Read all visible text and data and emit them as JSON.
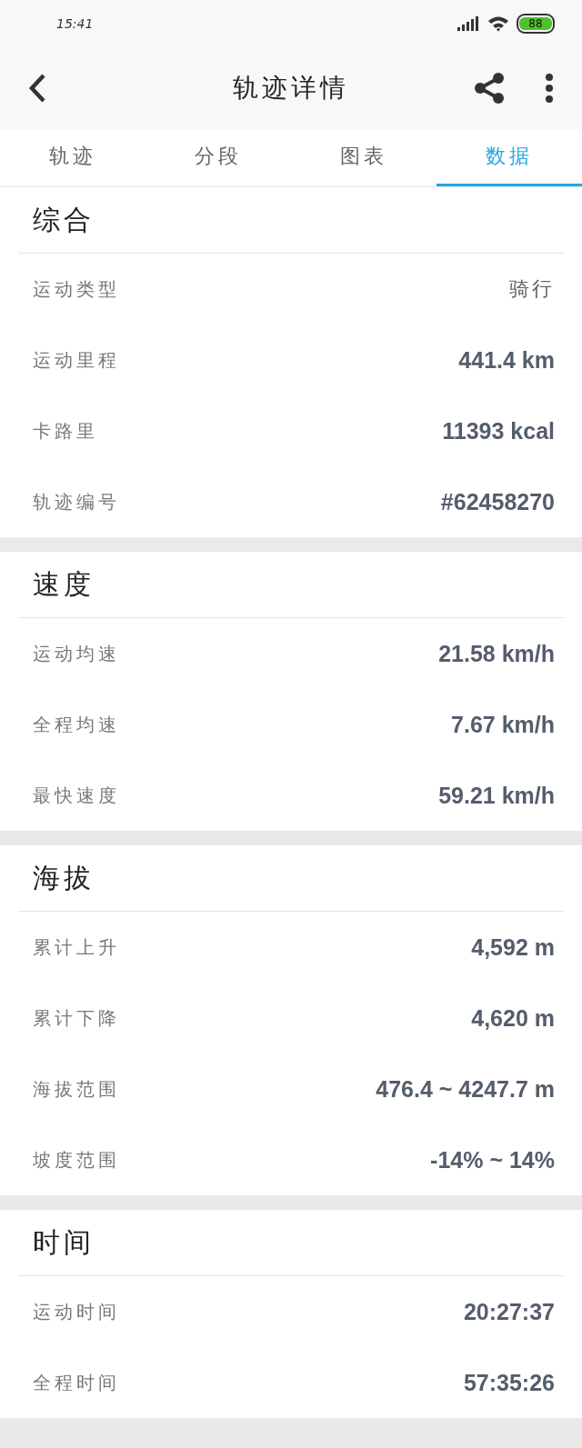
{
  "status_bar": {
    "time": "15:41",
    "battery": "88"
  },
  "toolbar": {
    "title": "轨迹详情"
  },
  "tabs": [
    {
      "label": "轨迹",
      "selected": false
    },
    {
      "label": "分段",
      "selected": false
    },
    {
      "label": "图表",
      "selected": false
    },
    {
      "label": "数据",
      "selected": true
    }
  ],
  "sections": [
    {
      "title": "综合",
      "rows": [
        {
          "label": "运动类型",
          "value": "骑行",
          "kind": "text"
        },
        {
          "label": "运动里程",
          "value": "441.4 km",
          "kind": "number"
        },
        {
          "label": "卡路里",
          "value": "11393 kcal",
          "kind": "number"
        },
        {
          "label": "轨迹编号",
          "value": "#62458270",
          "kind": "number"
        }
      ]
    },
    {
      "title": "速度",
      "rows": [
        {
          "label": "运动均速",
          "value": "21.58 km/h",
          "kind": "number"
        },
        {
          "label": "全程均速",
          "value": "7.67 km/h",
          "kind": "number"
        },
        {
          "label": "最快速度",
          "value": "59.21 km/h",
          "kind": "number"
        }
      ]
    },
    {
      "title": "海拔",
      "rows": [
        {
          "label": "累计上升",
          "value": "4,592 m",
          "kind": "number"
        },
        {
          "label": "累计下降",
          "value": "4,620 m",
          "kind": "number"
        },
        {
          "label": "海拔范围",
          "value": "476.4 ~ 4247.7 m",
          "kind": "number"
        },
        {
          "label": "坡度范围",
          "value": "-14% ~ 14%",
          "kind": "number"
        }
      ]
    },
    {
      "title": "时间",
      "rows": [
        {
          "label": "运动时间",
          "value": "20:27:37",
          "kind": "number"
        },
        {
          "label": "全程时间",
          "value": "57:35:26",
          "kind": "number"
        }
      ]
    }
  ]
}
